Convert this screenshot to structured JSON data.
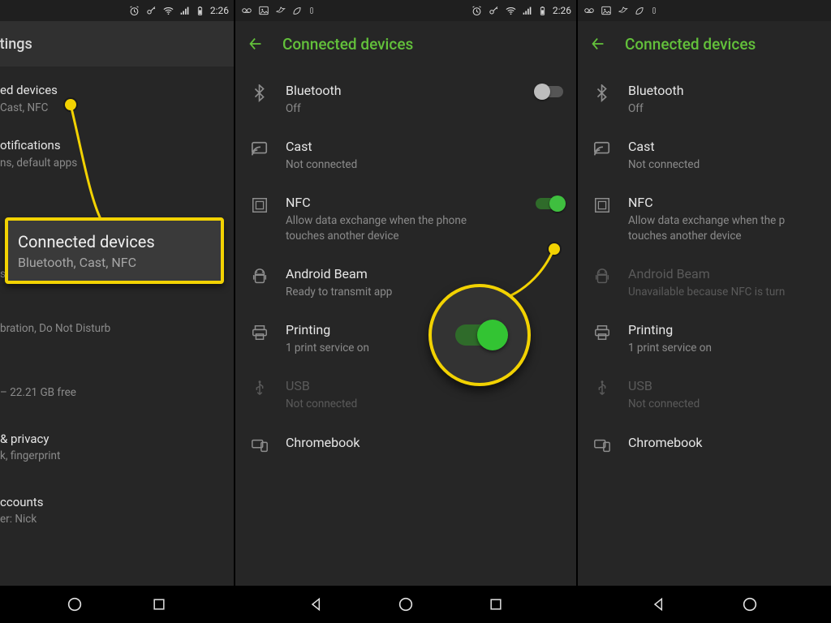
{
  "statusbar_time": "2:26",
  "colors": {
    "accent": "#63c13b",
    "highlight": "#f2d202",
    "toggle_on": "#3fbf3f"
  },
  "panel1": {
    "appbar_title": "ettings",
    "rows": [
      {
        "primary": "ed devices",
        "secondary": "Cast, NFC"
      },
      {
        "primary": "otifications",
        "secondary": "ns, default apps"
      },
      {
        "primary": "",
        "secondary": "sleep, font size"
      },
      {
        "primary": "",
        "secondary": "bration, Do Not Disturb"
      },
      {
        "primary": "",
        "secondary": "– 22.21 GB free"
      },
      {
        "primary": "& privacy",
        "secondary": "k, fingerprint"
      },
      {
        "primary": "ccounts",
        "secondary": "er: Nick"
      }
    ],
    "callout": {
      "title": "Connected devices",
      "subtitle": "Bluetooth, Cast, NFC"
    }
  },
  "panel2": {
    "appbar_title": "Connected devices",
    "rows": [
      {
        "icon": "bluetooth-icon",
        "primary": "Bluetooth",
        "secondary": "Off",
        "toggle": "off"
      },
      {
        "icon": "cast-icon",
        "primary": "Cast",
        "secondary": "Not connected"
      },
      {
        "icon": "nfc-icon",
        "primary": "NFC",
        "secondary": "Allow data exchange when the phone touches another device",
        "toggle": "on"
      },
      {
        "icon": "android-icon",
        "primary": "Android Beam",
        "secondary": "Ready to transmit app"
      },
      {
        "icon": "printer-icon",
        "primary": "Printing",
        "secondary": "1 print service on"
      },
      {
        "icon": "usb-icon",
        "primary": "USB",
        "secondary": "Not connected",
        "disabled": true
      },
      {
        "icon": "devices-icon",
        "primary": "Chromebook",
        "secondary": ""
      }
    ]
  },
  "panel3": {
    "appbar_title": "Connected devices",
    "rows": [
      {
        "icon": "bluetooth-icon",
        "primary": "Bluetooth",
        "secondary": "Off"
      },
      {
        "icon": "cast-icon",
        "primary": "Cast",
        "secondary": "Not connected"
      },
      {
        "icon": "nfc-icon",
        "primary": "NFC",
        "secondary": "Allow data exchange when the p touches another device"
      },
      {
        "icon": "android-icon",
        "primary": "Android Beam",
        "secondary": "Unavailable because NFC is turn",
        "disabled": true
      },
      {
        "icon": "printer-icon",
        "primary": "Printing",
        "secondary": "1 print service on"
      },
      {
        "icon": "usb-icon",
        "primary": "USB",
        "secondary": "Not connected",
        "disabled": true
      },
      {
        "icon": "devices-icon",
        "primary": "Chromebook",
        "secondary": ""
      }
    ]
  }
}
